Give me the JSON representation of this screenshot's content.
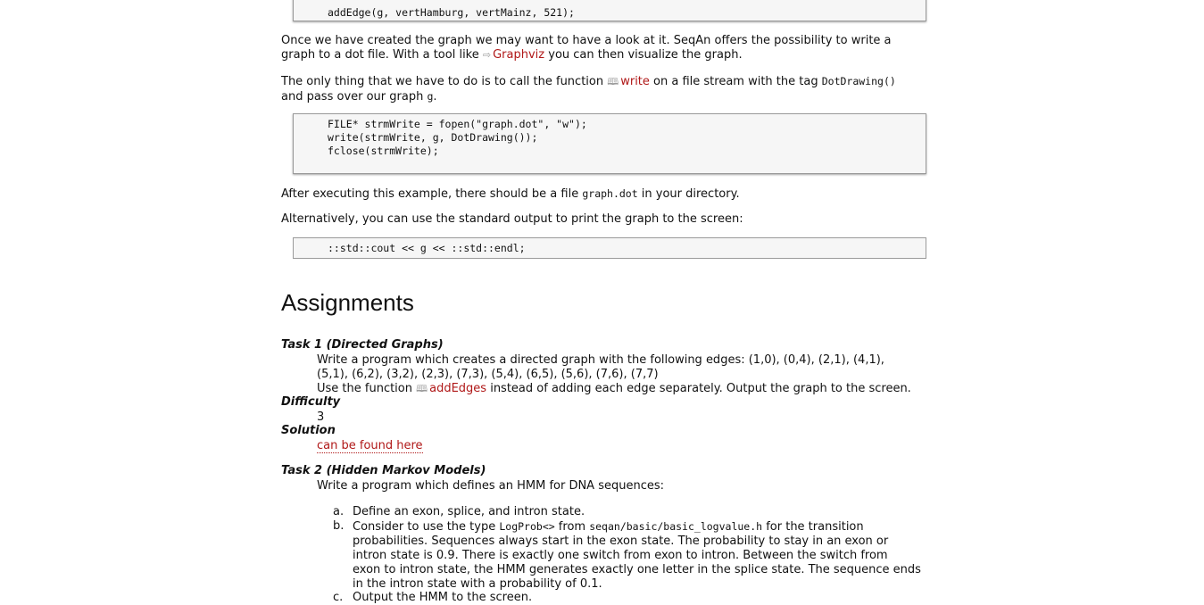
{
  "code_top": {
    "line": "addEdge(g, vertHamburg, vertMainz, 521);"
  },
  "para1": {
    "line1": "Once we have created the graph we may want to have a look at it. SeqAn offers the possibility to write a",
    "line2_pre": "graph to a dot file. With a tool like ",
    "graphviz_link": "Graphviz",
    "line2_post": " you can then visualize the graph."
  },
  "para2": {
    "pre": "The only thing that we have to do is to call the function ",
    "write_link": "write",
    "mid": " on a file stream with the tag ",
    "tag_code": "DotDrawing()",
    "line2_pre": "and pass over our graph ",
    "g_code": "g",
    "line2_post": "."
  },
  "code_write": {
    "l1": "FILE* strmWrite = fopen(\"graph.dot\", \"w\");",
    "l2": "write(strmWrite, g, DotDrawing());",
    "l3": "fclose(strmWrite);"
  },
  "para3": {
    "pre": "After executing this example, there should be a file ",
    "file_code": "graph.dot",
    "post": " in your directory."
  },
  "para4": "Alternatively, you can use the standard output to print the graph to the screen:",
  "code_cout": "::std::cout << g << ::std::endl;",
  "assignments_heading": "Assignments",
  "task1": {
    "title": "Task 1 (Directed Graphs)",
    "line1": "Write a program which creates a directed graph with the following edges: (1,0), (0,4), (2,1), (4,1),",
    "line2": "(5,1), (6,2), (3,2), (2,3), (7,3), (5,4), (6,5), (5,6), (7,6), (7,7)",
    "line3_pre": "Use the function ",
    "addedges_link": "addEdges",
    "line3_post": " instead of adding each edge separately. Output the graph to the screen.",
    "difficulty_label": "Difficulty",
    "difficulty_value": "3",
    "solution_label": "Solution",
    "solution_link": "can be found here"
  },
  "task2": {
    "title": "Task 2 (Hidden Markov Models)",
    "intro": "Write a program which defines an HMM for DNA sequences:",
    "items": [
      {
        "marker": "a.",
        "text": "Define an exon, splice, and intron state."
      },
      {
        "marker": "b.",
        "pre": "Consider to use the type ",
        "type_code": "LogProb<>",
        "mid": " from ",
        "header_code": "seqan/basic/basic_logvalue.h",
        "post": " for the transition",
        "l2": "probabilities. Sequences always start in the exon state. The probability to stay in an exon or",
        "l3": "intron state is 0.9. There is exactly one switch from exon to intron. Between the switch from",
        "l4": "exon to intron state, the HMM generates exactly one letter in the splice state. The sequence ends",
        "l5": "in the intron state with a probability of 0.1."
      },
      {
        "marker": "c.",
        "text": "Output the HMM to the screen."
      }
    ]
  }
}
